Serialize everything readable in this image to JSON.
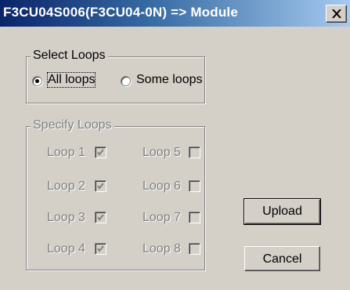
{
  "window": {
    "title": "F3CU04S006(F3CU04-0N) => Module",
    "close_glyph": "✕"
  },
  "select_loops": {
    "legend": "Select Loops",
    "options": [
      {
        "label": "All loops",
        "selected": true
      },
      {
        "label": "Some loops",
        "selected": false
      }
    ]
  },
  "specify_loops": {
    "legend": "Specify Loops",
    "enabled": false,
    "loops": [
      {
        "label": "Loop 1",
        "checked": true
      },
      {
        "label": "Loop 2",
        "checked": true
      },
      {
        "label": "Loop 3",
        "checked": true
      },
      {
        "label": "Loop 4",
        "checked": true
      },
      {
        "label": "Loop 5",
        "checked": false
      },
      {
        "label": "Loop 6",
        "checked": false
      },
      {
        "label": "Loop 7",
        "checked": false
      },
      {
        "label": "Loop 8",
        "checked": false
      }
    ]
  },
  "buttons": {
    "upload_label": "Upload",
    "cancel_label": "Cancel"
  },
  "colors": {
    "title_start": "#0a246a",
    "title_end": "#a6caf0",
    "face": "#d4d0c8",
    "disabled_text": "#808080"
  }
}
